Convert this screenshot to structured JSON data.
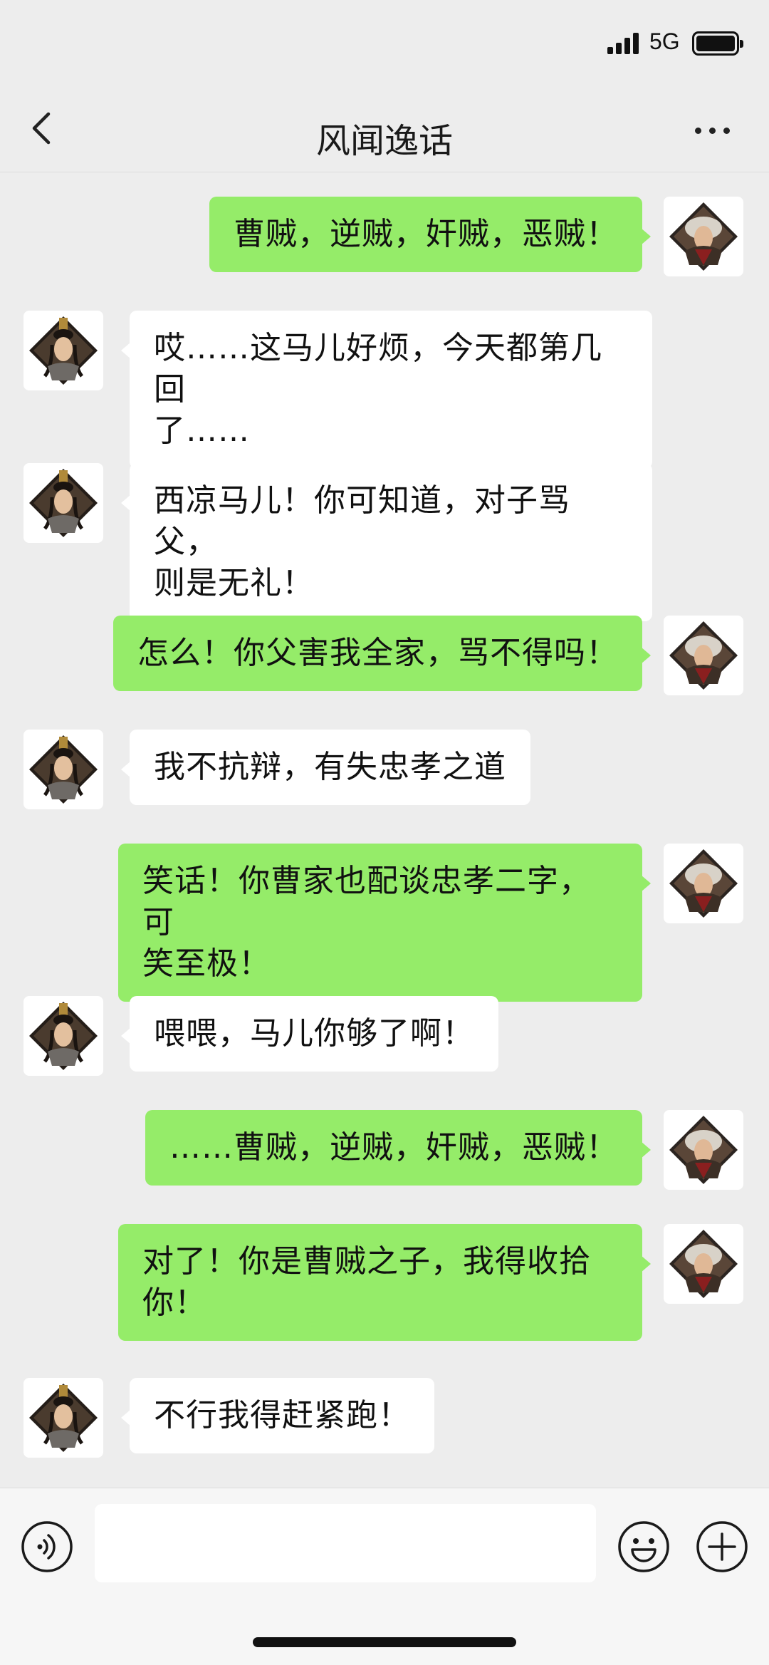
{
  "status_bar": {
    "network": "5G",
    "signal_icon": "cellular-signal-icon",
    "battery_icon": "battery-full-icon"
  },
  "header": {
    "title": "风闻逸话",
    "back_icon": "chevron-left-icon",
    "more_icon": "more-horizontal-icon"
  },
  "messages": [
    {
      "sender": "me",
      "lines": [
        "曹贼，逆贼，奸贼，恶贼！"
      ]
    },
    {
      "sender": "other",
      "lines": [
        "哎……这马儿好烦，今天都第几回",
        "了……"
      ]
    },
    {
      "sender": "other",
      "lines": [
        "西凉马儿！你可知道，对子骂父，",
        "则是无礼！"
      ]
    },
    {
      "sender": "me",
      "lines": [
        "怎么！你父害我全家，骂不得吗！"
      ]
    },
    {
      "sender": "other",
      "lines": [
        "我不抗辩，有失忠孝之道"
      ]
    },
    {
      "sender": "me",
      "lines": [
        "笑话！你曹家也配谈忠孝二字，可",
        "笑至极！"
      ]
    },
    {
      "sender": "other",
      "lines": [
        "喂喂，马儿你够了啊！"
      ]
    },
    {
      "sender": "me",
      "lines": [
        "……曹贼，逆贼，奸贼，恶贼！"
      ]
    },
    {
      "sender": "me",
      "lines": [
        "对了！你是曹贼之子，我得收拾",
        "你！"
      ]
    },
    {
      "sender": "other",
      "lines": [
        "不行我得赶紧跑！"
      ]
    }
  ],
  "input_bar": {
    "voice_icon": "voice-icon",
    "emoji_icon": "emoji-icon",
    "plus_icon": "plus-icon",
    "input_value": "",
    "input_placeholder": ""
  },
  "colors": {
    "background": "#ededed",
    "my_bubble": "#95ec69",
    "other_bubble": "#ffffff"
  }
}
